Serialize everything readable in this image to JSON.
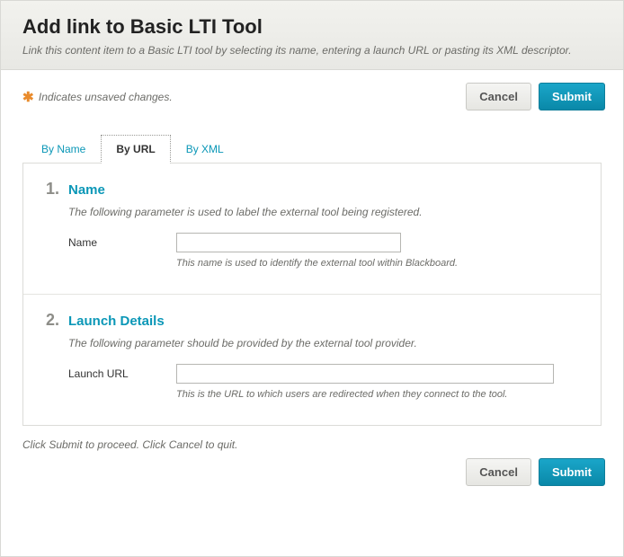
{
  "header": {
    "title": "Add link to Basic LTI Tool",
    "subtitle": "Link this content item to a Basic LTI tool by selecting its name, entering a launch URL or pasting its XML descriptor."
  },
  "unsaved": {
    "text": "Indicates unsaved changes."
  },
  "buttons": {
    "cancel": "Cancel",
    "submit": "Submit"
  },
  "tabs": {
    "by_name": "By Name",
    "by_url": "By URL",
    "by_xml": "By XML",
    "active": "by_url"
  },
  "sections": {
    "name": {
      "number": "1.",
      "title": "Name",
      "desc": "The following parameter is used to label the external tool being registered.",
      "field_label": "Name",
      "value": "",
      "hint": "This name is used to identify the external tool within Blackboard."
    },
    "launch": {
      "number": "2.",
      "title": "Launch Details",
      "desc": "The following parameter should be provided by the external tool provider.",
      "field_label": "Launch URL",
      "value": "",
      "hint": "This is the URL to which users are redirected when they connect to the tool."
    }
  },
  "footer": {
    "text": "Click Submit to proceed. Click Cancel to quit."
  }
}
